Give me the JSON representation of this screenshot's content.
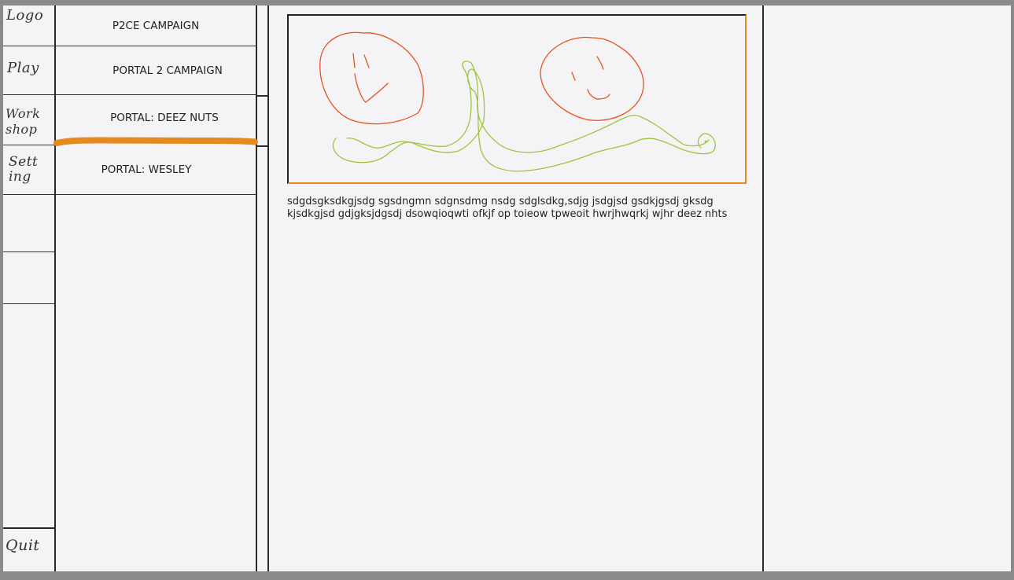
{
  "sidebar": {
    "items": [
      {
        "label": "Logo"
      },
      {
        "label": "Play"
      },
      {
        "label": "Work shop"
      },
      {
        "label": "Sett ing"
      },
      {
        "label": "Quit"
      }
    ]
  },
  "campaigns": {
    "items": [
      {
        "label": "P2CE CAMPAIGN"
      },
      {
        "label": "PORTAL 2 CAMPAIGN"
      },
      {
        "label": "PORTAL: DEEZ NUTS"
      },
      {
        "label": "PORTAL: WESLEY"
      }
    ],
    "selected_index": 2,
    "highlight_color": "#e58a1f"
  },
  "detail": {
    "description": "sdgdsgksdkgjsdg sgsdngmn sdgnsdmg nsdg sdglsdkg,sdjg jsdgjsd gsdkjgsdj gksdg kjsdkgjsd gdjgksjdgsdj dsowqioqwti ofkjf op toieow tpweoit hwrjhwqrkj wjhr deez nhts",
    "preview_colors": {
      "faces": "#e8521f",
      "worm": "#9ec43a"
    }
  }
}
